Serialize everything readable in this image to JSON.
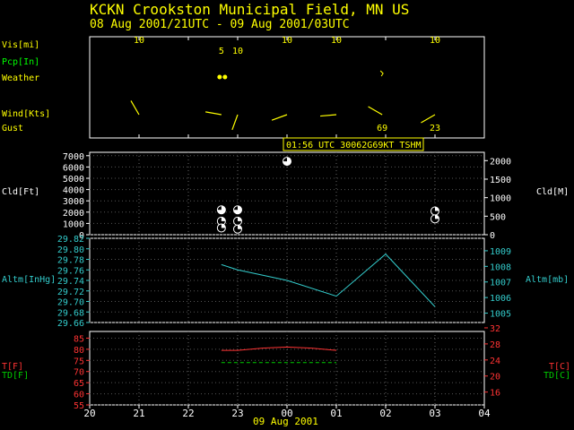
{
  "header": {
    "title": "KCKN  Crookston Municipal Field, MN US",
    "subtitle": "08 Aug 2001/21UTC - 09 Aug 2001/03UTC"
  },
  "colors": {
    "title": "#ffff00",
    "frame": "#ffffff",
    "vis": "#ffff00",
    "pcp": "#00ff00",
    "weather": "#ffff00",
    "wind": "#ffff00",
    "gust": "#ffff00",
    "altim_inhg": "#33cccc",
    "altim_mb": "#33cccc",
    "temp": "#ff3333",
    "dewpoint": "#00cc00",
    "cloud_axis": "#ffffff",
    "tooltip_text": "#ffff00",
    "tooltip_border": "#ffff00",
    "tooltip_bg": "#000000"
  },
  "labels": {
    "vis": "Vis[mi]",
    "pcp": "Pcp[In]",
    "weather": "Weather",
    "wind": "Wind[Kts]",
    "gust": "Gust",
    "cld_ft": "Cld[Ft]",
    "cld_m": "Cld[M]",
    "altim_inhg": "Altm[InHg]",
    "altim_mb": "Altm[mb]",
    "temp_f": "T[F]",
    "dew_f": "TD[F]",
    "temp_c": "T[C]",
    "dew_c": "TD[C]"
  },
  "tooltip": "01:56 UTC 30062G69KT TSHM",
  "x_axis": {
    "ticks": [
      20,
      21,
      22,
      23,
      0,
      1,
      2,
      3,
      4
    ],
    "tick_labels": [
      "20",
      "21",
      "22",
      "23",
      "00",
      "01",
      "02",
      "03",
      "04"
    ],
    "date_label": "09 Aug 2001"
  },
  "chart_data": {
    "type": "line",
    "title": "KCKN  Crookston Municipal Field, MN US",
    "subtitle": "08 Aug 2001/21UTC - 09 Aug 2001/03UTC",
    "x_range": [
      20,
      28
    ],
    "visibility_mi": [
      {
        "x": 21.0,
        "v": "10"
      },
      {
        "x": 22.67,
        "v": "5"
      },
      {
        "x": 23.0,
        "v": "10"
      },
      {
        "x": 24.0,
        "v": "10"
      },
      {
        "x": 25.0,
        "v": "10"
      },
      {
        "x": 27.0,
        "v": "10"
      }
    ],
    "weather_symbols": [
      {
        "x": 22.67,
        "symbol": "rain-dots"
      },
      {
        "x": 25.93,
        "symbol": "thunder"
      }
    ],
    "wind_barbs": [
      {
        "x": 21.0,
        "dir": 330
      },
      {
        "x": 22.67,
        "dir": 280
      },
      {
        "x": 23.0,
        "dir": 200
      },
      {
        "x": 24.0,
        "dir": 250
      },
      {
        "x": 25.0,
        "dir": 265
      },
      {
        "x": 25.93,
        "dir": 300
      },
      {
        "x": 27.0,
        "dir": 240
      }
    ],
    "gusts_kts": [
      {
        "x": 25.93,
        "v": "69"
      },
      {
        "x": 27.0,
        "v": "23"
      }
    ],
    "clouds": {
      "ft_ticks": [
        0,
        1000,
        2000,
        3000,
        4000,
        5000,
        6000,
        7000
      ],
      "m_ticks": [
        0,
        500,
        1000,
        1500,
        2000
      ],
      "ft_range": [
        0,
        7300
      ],
      "m_range": [
        0,
        2225
      ],
      "layers": [
        {
          "x": 22.67,
          "ft": 2200,
          "cover": "BKN"
        },
        {
          "x": 22.67,
          "ft": 1200,
          "cover": "SCT"
        },
        {
          "x": 22.67,
          "ft": 600,
          "cover": "SCT"
        },
        {
          "x": 23.0,
          "ft": 2200,
          "cover": "BKN"
        },
        {
          "x": 23.0,
          "ft": 1200,
          "cover": "SCT"
        },
        {
          "x": 23.0,
          "ft": 500,
          "cover": "SCT"
        },
        {
          "x": 24.0,
          "ft": 6500,
          "cover": "BKN"
        },
        {
          "x": 27.0,
          "ft": 2100,
          "cover": "SCT"
        },
        {
          "x": 27.0,
          "ft": 1400,
          "cover": "SCT"
        }
      ]
    },
    "altimeter": {
      "inhg_ticks": [
        29.66,
        29.68,
        29.7,
        29.72,
        29.74,
        29.76,
        29.78,
        29.8,
        29.82
      ],
      "mb_ticks": [
        1005,
        1006,
        1007,
        1008,
        1009
      ],
      "ylim_inhg": [
        29.66,
        29.82
      ],
      "ylim_mb": [
        1004.4,
        1009.8
      ],
      "x": [
        22.67,
        23.0,
        24.0,
        25.0,
        26.0,
        27.0
      ],
      "values_inhg": [
        29.77,
        29.76,
        29.74,
        29.71,
        29.79,
        29.69
      ]
    },
    "temperature": {
      "f_ticks": [
        55,
        60,
        65,
        70,
        75,
        80,
        85
      ],
      "c_ticks": [
        16,
        20,
        24,
        28,
        32
      ],
      "ylim_f": [
        55,
        88
      ],
      "ylim_c": [
        12.8,
        31.1
      ],
      "temp_f": {
        "x": [
          22.67,
          23.0,
          23.5,
          24.0,
          24.5,
          25.0
        ],
        "values": [
          79.5,
          79.5,
          80.5,
          81.0,
          80.5,
          79.5
        ]
      },
      "dewpoint_f": {
        "x": [
          22.67,
          25.0
        ],
        "values": [
          74,
          74
        ]
      }
    }
  }
}
